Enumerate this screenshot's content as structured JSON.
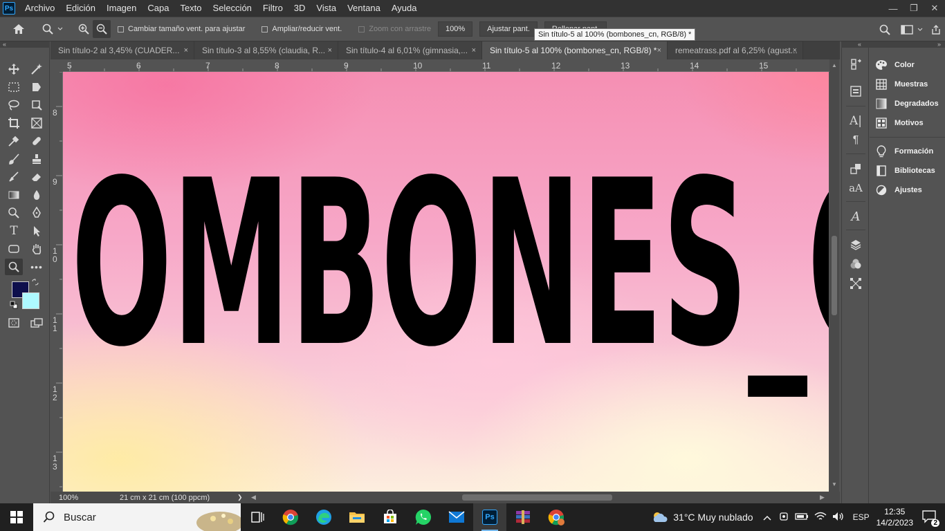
{
  "app": {
    "logo": "Ps"
  },
  "menu": [
    "Archivo",
    "Edición",
    "Imagen",
    "Capa",
    "Texto",
    "Selección",
    "Filtro",
    "3D",
    "Vista",
    "Ventana",
    "Ayuda"
  ],
  "window_controls": {
    "minimize": "—",
    "restore": "❐",
    "close": "✕"
  },
  "options": {
    "resize_windows": "Cambiar tamaño vent. para ajustar",
    "zoom_all": "Ampliar/reducir vent.",
    "scrubby_zoom": "Zoom con arrastre",
    "zoom_value": "100%",
    "fit_screen": "Ajustar pant.",
    "fill_screen": "Rellenar pant."
  },
  "tooltip": "Sin título-5 al 100% (bombones_cn, RGB/8) *",
  "tabs": [
    {
      "label": "Sin título-2 al 3,45% (CUADER...",
      "close": "×"
    },
    {
      "label": "Sin título-3 al 8,55% (claudia, R...",
      "close": "×"
    },
    {
      "label": "Sin título-4 al 6,01% (gimnasia,...",
      "close": "×"
    },
    {
      "label": "Sin título-5 al 100% (bombones_cn, RGB/8) *",
      "close": "×"
    },
    {
      "label": "remeatrass.pdf al 6,25% (agust...",
      "close": "×"
    }
  ],
  "ruler_top": [
    "5",
    "6",
    "7",
    "8",
    "9",
    "10",
    "11",
    "12",
    "13",
    "14",
    "15"
  ],
  "ruler_left": [
    {
      "line1": "8",
      "line2": ""
    },
    {
      "line1": "9",
      "line2": ""
    },
    {
      "line1": "1",
      "line2": "0"
    },
    {
      "line1": "1",
      "line2": "1"
    },
    {
      "line1": "1",
      "line2": "2"
    },
    {
      "line1": "1",
      "line2": "3"
    }
  ],
  "canvas": {
    "text": "OMBONES_C"
  },
  "colors": {
    "foreground": "#0e0f4c",
    "background": "#aef9ff"
  },
  "status": {
    "zoom": "100%",
    "doc_size": "21 cm x 21 cm (100 ppcm)",
    "arrow": "❯"
  },
  "panels": [
    {
      "label": "Color",
      "icon": "palette-icon"
    },
    {
      "label": "Muestras",
      "icon": "swatches-icon"
    },
    {
      "label": "Degradados",
      "icon": "gradient-icon"
    },
    {
      "label": "Motivos",
      "icon": "patterns-icon"
    },
    {
      "label": "Formación",
      "icon": "lightbulb-icon"
    },
    {
      "label": "Bibliotecas",
      "icon": "libraries-icon"
    },
    {
      "label": "Ajustes",
      "icon": "adjustments-icon"
    }
  ],
  "taskbar": {
    "search_placeholder": "Buscar",
    "weather": "31°C  Muy nublado",
    "language": "ESP",
    "time": "12:35",
    "date": "14/2/2023",
    "notifications": "2"
  }
}
